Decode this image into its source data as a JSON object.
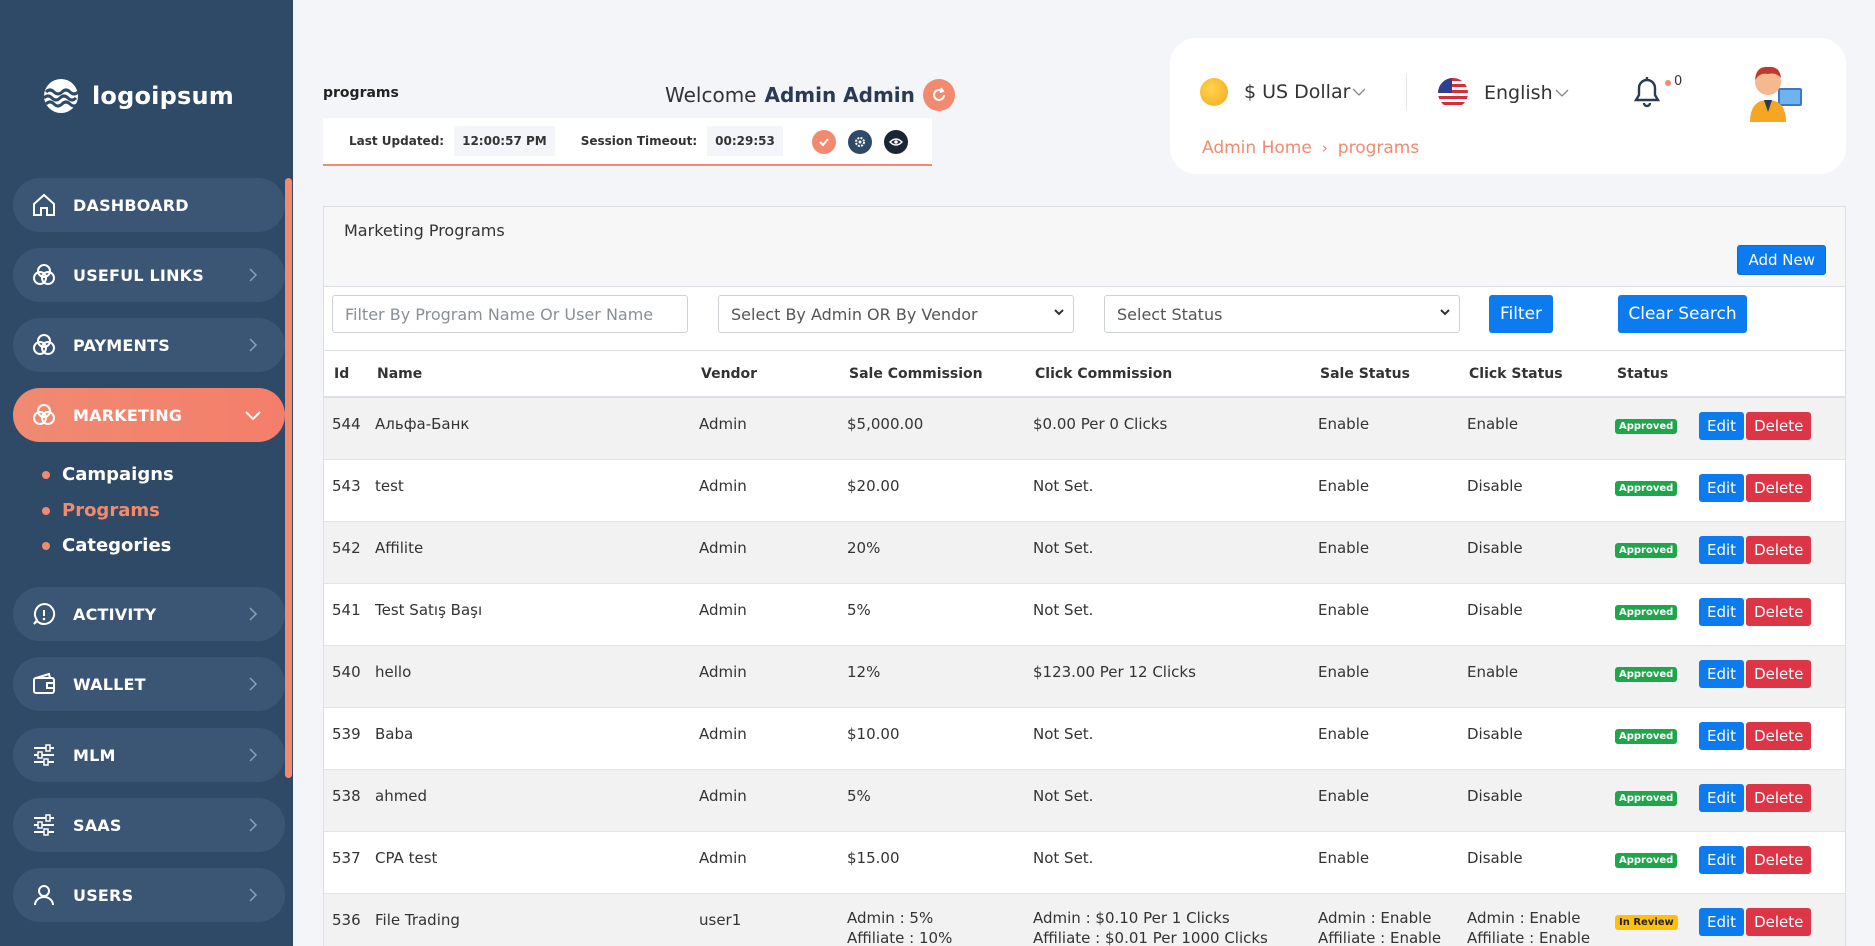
{
  "brand": {
    "name": "logoipsum"
  },
  "sidebar": {
    "items": [
      {
        "label": "DASHBOARD",
        "icon": "home-icon"
      },
      {
        "label": "USEFUL LINKS",
        "icon": "links-icon"
      },
      {
        "label": "PAYMENTS",
        "icon": "payments-icon"
      },
      {
        "label": "MARKETING",
        "icon": "marketing-icon"
      },
      {
        "label": "ACTIVITY",
        "icon": "activity-icon"
      },
      {
        "label": "WALLET",
        "icon": "wallet-icon"
      },
      {
        "label": "MLM",
        "icon": "sliders-icon"
      },
      {
        "label": "SAAS",
        "icon": "sliders-icon"
      },
      {
        "label": "USERS",
        "icon": "users-icon"
      }
    ],
    "marketing_sub": [
      "Campaigns",
      "Programs",
      "Categories"
    ]
  },
  "header": {
    "page": "programs",
    "welcome_prefix": "Welcome",
    "welcome_user": "Admin Admin",
    "last_updated_label": "Last Updated:",
    "last_updated_value": "12:00:57 PM",
    "session_timeout_label": "Session Timeout:",
    "session_timeout_value": "00:29:53"
  },
  "topbar": {
    "currency": "$ US Dollar",
    "language": "English",
    "notifications": "0",
    "breadcrumb": [
      "Admin Home",
      "programs"
    ]
  },
  "panel": {
    "title": "Marketing Programs",
    "add_new": "Add New",
    "filter_placeholder": "Filter By Program Name Or User Name",
    "vendor_select": "Select By Admin OR By Vendor",
    "status_select": "Select Status",
    "filter_button": "Filter",
    "clear_button": "Clear Search"
  },
  "table": {
    "columns": [
      "Id",
      "Name",
      "Vendor",
      "Sale Commission",
      "Click Commission",
      "Sale Status",
      "Click Status",
      "Status"
    ],
    "edit_label": "Edit",
    "delete_label": "Delete",
    "rows": [
      {
        "id": "544",
        "name": "Альфа-Банк",
        "vendor": "Admin",
        "sale": "$5,000.00",
        "click": "$0.00 Per 0 Clicks",
        "sale_status": "Enable",
        "click_status": "Enable",
        "status": "Approved"
      },
      {
        "id": "543",
        "name": "test",
        "vendor": "Admin",
        "sale": "$20.00",
        "click": "Not Set.",
        "sale_status": "Enable",
        "click_status": "Disable",
        "status": "Approved"
      },
      {
        "id": "542",
        "name": "Affilite",
        "vendor": "Admin",
        "sale": "20%",
        "click": "Not Set.",
        "sale_status": "Enable",
        "click_status": "Disable",
        "status": "Approved"
      },
      {
        "id": "541",
        "name": "Test Satış Başı",
        "vendor": "Admin",
        "sale": "5%",
        "click": "Not Set.",
        "sale_status": "Enable",
        "click_status": "Disable",
        "status": "Approved"
      },
      {
        "id": "540",
        "name": "hello",
        "vendor": "Admin",
        "sale": "12%",
        "click": "$123.00 Per 12 Clicks",
        "sale_status": "Enable",
        "click_status": "Enable",
        "status": "Approved"
      },
      {
        "id": "539",
        "name": "Baba",
        "vendor": "Admin",
        "sale": "$10.00",
        "click": "Not Set.",
        "sale_status": "Enable",
        "click_status": "Disable",
        "status": "Approved"
      },
      {
        "id": "538",
        "name": "ahmed",
        "vendor": "Admin",
        "sale": "5%",
        "click": "Not Set.",
        "sale_status": "Enable",
        "click_status": "Disable",
        "status": "Approved"
      },
      {
        "id": "537",
        "name": "CPA test",
        "vendor": "Admin",
        "sale": "$15.00",
        "click": "Not Set.",
        "sale_status": "Enable",
        "click_status": "Disable",
        "status": "Approved"
      }
    ],
    "last_row": {
      "id": "536",
      "name": "File Trading",
      "vendor": "user1",
      "sale_1": "Admin : 5%",
      "sale_2": "Affiliate : 10%",
      "click_1": "Admin : $0.10 Per 1 Clicks",
      "click_2": "Affiliate : $0.01 Per 1000 Clicks",
      "sale_status_1": "Admin : Enable",
      "sale_status_2": "Affiliate : Enable",
      "click_status_1": "Admin : Enable",
      "click_status_2": "Affiliate : Enable",
      "status": "In Review"
    }
  }
}
